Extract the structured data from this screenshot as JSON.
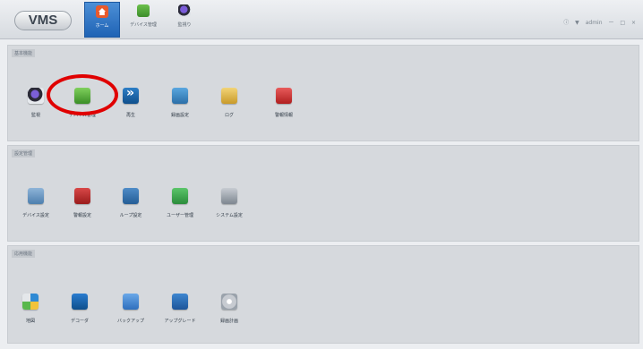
{
  "app": {
    "logo": "VMS"
  },
  "navbar": {
    "tabs": [
      {
        "label": "ホーム",
        "icon": "home-icon",
        "active": true
      },
      {
        "label": "デバイス管理",
        "icon": "device-icon",
        "active": false
      },
      {
        "label": "監視り",
        "icon": "monitor-icon",
        "active": false
      }
    ],
    "window_controls": [
      "ⓘ",
      "▼",
      "ー",
      "□",
      "×"
    ],
    "user_label": "admin"
  },
  "sections": [
    {
      "title": "基本機能",
      "items": [
        {
          "label": "監視",
          "icon": "monitor-icon"
        },
        {
          "label": "デバイス管理",
          "icon": "device-management-icon"
        },
        {
          "label": "再生",
          "icon": "playback-icon"
        },
        {
          "label": "録画設定",
          "icon": "record-settings-icon"
        },
        {
          "label": "ログ",
          "icon": "log-icon"
        },
        {
          "label": "警報情報",
          "icon": "alarm-info-icon"
        }
      ]
    },
    {
      "title": "設定管理",
      "items": [
        {
          "label": "デバイス設定",
          "icon": "device-settings-icon"
        },
        {
          "label": "警報設定",
          "icon": "alarm-settings-icon"
        },
        {
          "label": "ループ設定",
          "icon": "loop-settings-icon"
        },
        {
          "label": "ユーザー管理",
          "icon": "user-management-icon"
        },
        {
          "label": "システム設定",
          "icon": "system-settings-icon"
        }
      ]
    },
    {
      "title": "応用機能",
      "items": [
        {
          "label": "地図",
          "icon": "map-icon"
        },
        {
          "label": "デコーダ",
          "icon": "decoder-icon"
        },
        {
          "label": "バックアップ",
          "icon": "backup-icon"
        },
        {
          "label": "アップグレード",
          "icon": "upgrade-icon"
        },
        {
          "label": "録画計画",
          "icon": "schedule-icon"
        }
      ]
    }
  ]
}
